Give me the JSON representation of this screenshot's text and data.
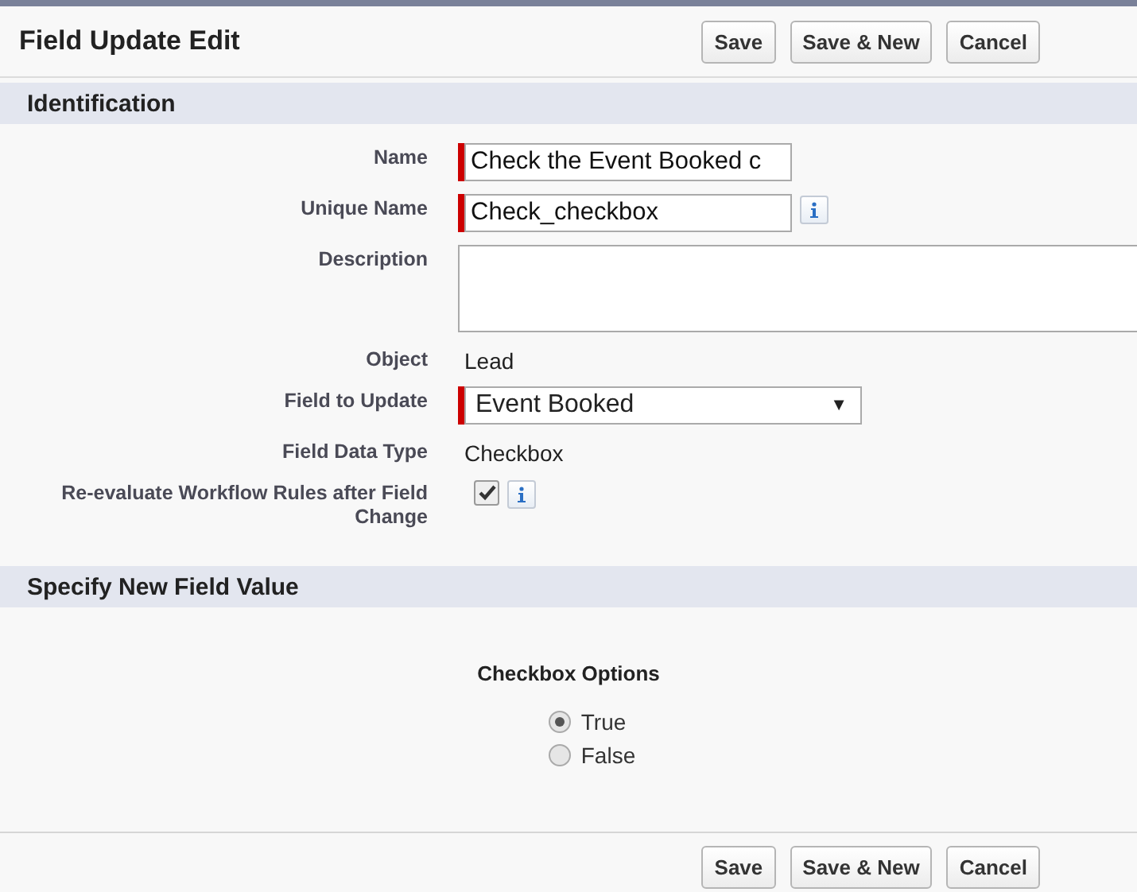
{
  "header": {
    "title": "Field Update Edit",
    "buttons": [
      "Save",
      "Save & New",
      "Cancel"
    ]
  },
  "sections": [
    {
      "title": "Identification",
      "fields": [
        {
          "kind": "text",
          "label": "Name",
          "value": "Check the Event Booked c",
          "required": true
        },
        {
          "kind": "text",
          "label": "Unique Name",
          "value": "Check_checkbox",
          "required": true,
          "info": true
        },
        {
          "kind": "textarea",
          "label": "Description"
        },
        {
          "kind": "static",
          "label": "Object",
          "value": "Lead"
        },
        {
          "kind": "select",
          "label": "Field to Update",
          "value": "Event Booked",
          "caret": "▼",
          "required": true
        },
        {
          "kind": "static",
          "label": "Field Data Type",
          "value": "Checkbox"
        },
        {
          "kind": "checkbox",
          "label": "Re-evaluate Workflow Rules after Field Change",
          "checked": true,
          "info": true
        }
      ]
    },
    {
      "title": "Specify New Field Value",
      "options_title": "Checkbox Options",
      "options": [
        {
          "label": "True",
          "selected": true
        },
        {
          "label": "False",
          "selected": false
        }
      ]
    }
  ],
  "footer": {
    "buttons": [
      "Save",
      "Save & New",
      "Cancel"
    ]
  }
}
